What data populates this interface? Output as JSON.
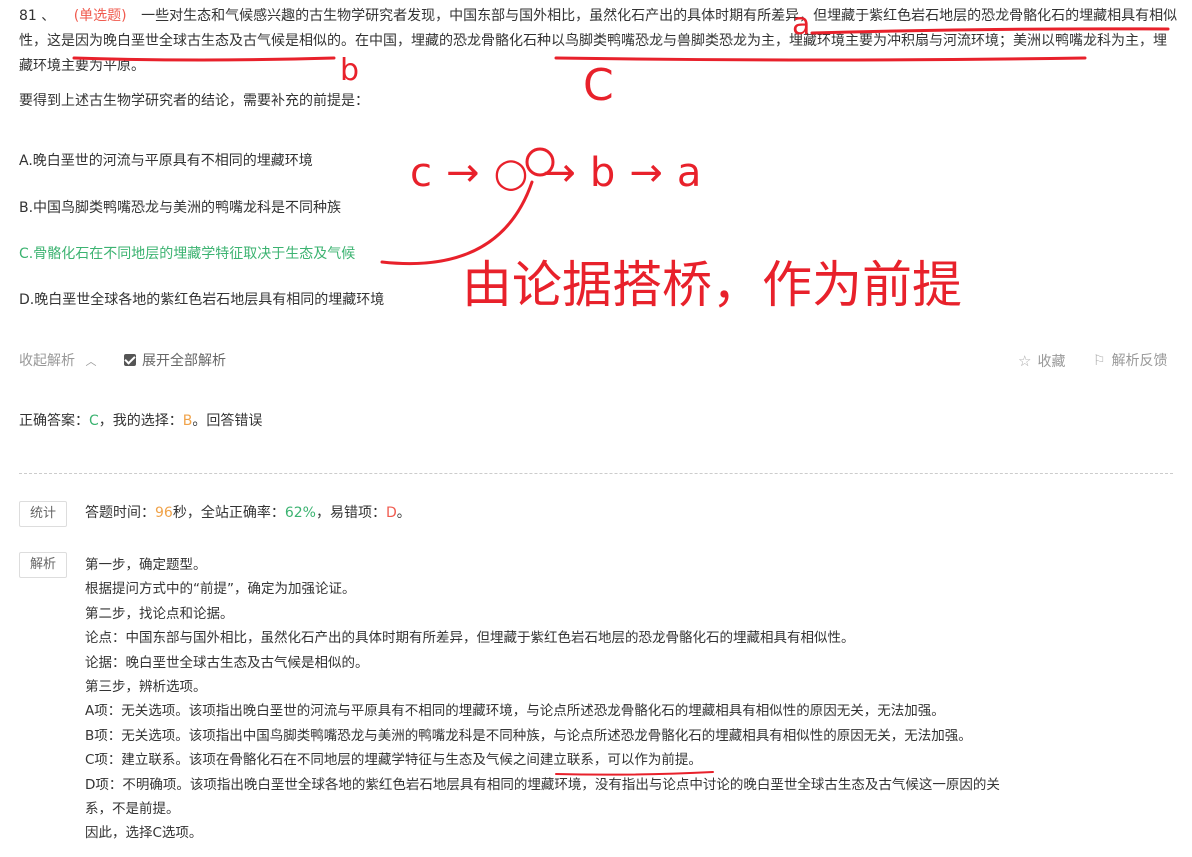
{
  "question": {
    "number": "81 、",
    "type": "(单选题)",
    "text_1": "一些对生态和气候感兴趣的古生物学研究者发现，中国东部与国外相比，虽然化石产出的具体时期有所差异，但埋藏于紫红色岩石地层的恐龙骨骼化石的埋藏相具有相似性，这是因为晚白垩世全球古生态及古气候是相似的。在中国，埋藏的恐龙骨骼化石种以鸟脚类鸭嘴恐龙与兽脚类恐龙为主，埋藏环境主要为冲积扇与河流环境；美洲以鸭嘴龙科为主，埋藏环境主要为平原。",
    "prompt": "要得到上述古生物学研究者的结论，需要补充的前提是："
  },
  "options": [
    {
      "label": "A.晚白垩世的河流与平原具有不相同的埋藏环境",
      "correct": false
    },
    {
      "label": "B.中国鸟脚类鸭嘴恐龙与美洲的鸭嘴龙科是不同种族",
      "correct": false
    },
    {
      "label": "C.骨骼化石在不同地层的埋藏学特征取决于生态及气候",
      "correct": true
    },
    {
      "label": "D.晚白垩世全球各地的紫红色岩石地层具有相同的埋藏环境",
      "correct": false
    }
  ],
  "toolbar": {
    "collapse": "收起解析",
    "expand_all": "展开全部解析",
    "favorite": "收藏",
    "feedback": "解析反馈"
  },
  "answer": {
    "label": "正确答案：",
    "correct": "C",
    "mid": "，我的选择：",
    "mine": "B",
    "result": "。回答错误"
  },
  "stats": {
    "tag": "统计",
    "time_label": "答题时间：",
    "time": "96",
    "time_unit": "秒，全站正确率：",
    "rate": "62%",
    "err_label": "，易错项：",
    "err": "D",
    "end": "。"
  },
  "analysis": {
    "tag": "解析",
    "lines": [
      "第一步，确定题型。",
      "根据提问方式中的“前提”，确定为加强论证。",
      "第二步，找论点和论据。",
      "论点：中国东部与国外相比，虽然化石产出的具体时期有所差异，但埋藏于紫红色岩石地层的恐龙骨骼化石的埋藏相具有相似性。",
      "论据：晚白垩世全球古生态及古气候是相似的。",
      "第三步，辨析选项。",
      "A项：无关选项。该项指出晚白垩世的河流与平原具有不相同的埋藏环境，与论点所述恐龙骨骼化石的埋藏相具有相似性的原因无关，无法加强。",
      "B项：无关选项。该项指出中国鸟脚类鸭嘴恐龙与美洲的鸭嘴龙科是不同种族，与论点所述恐龙骨骼化石的埋藏相具有相似性的原因无关，无法加强。",
      "C项：建立联系。该项在骨骼化石在不同地层的埋藏学特征与生态及气候之间建立联系，可以作为前提。",
      "D项：不明确项。该项指出晚白垩世全球各地的紫红色岩石地层具有相同的埋藏环境，没有指出与论点中讨论的晚白垩世全球古生态及古气候这一原因的关",
      "系，不是前提。",
      "因此，选择C选项。"
    ]
  },
  "handwriting": {
    "label_a": "a",
    "label_b": "b",
    "label_c": "C",
    "chain": "c→○→b→a",
    "note": "由论据搭桥，作为前提"
  },
  "colors": {
    "ink": "#e8212b",
    "correct": "#3cb371",
    "mine": "#f0a34a",
    "type": "#f05b4f"
  }
}
